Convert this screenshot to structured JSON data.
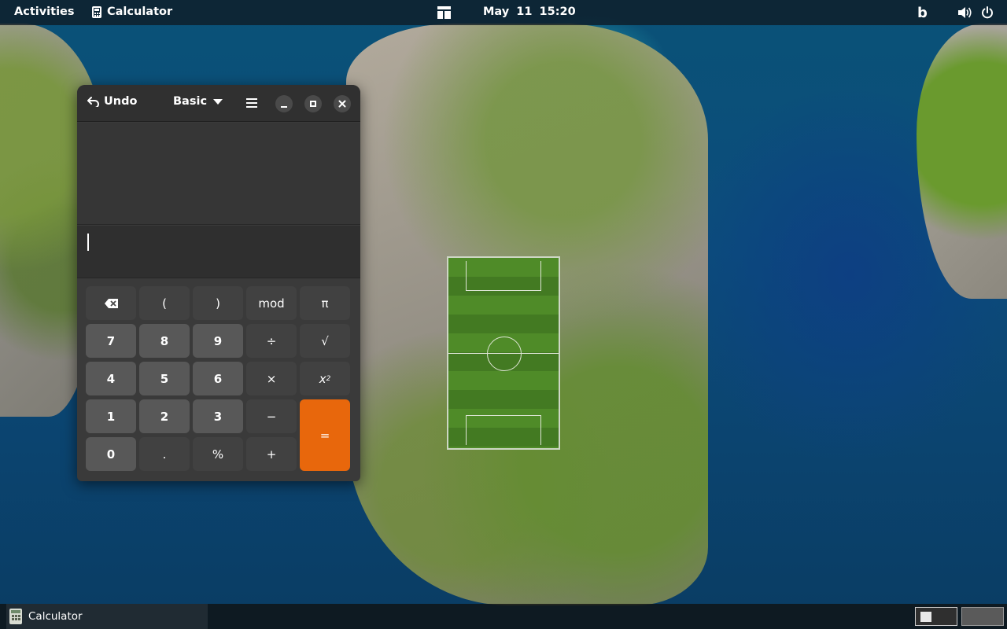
{
  "topbar": {
    "activities": "Activities",
    "app_name": "Calculator",
    "date": "May 11",
    "time": "15:20"
  },
  "window": {
    "undo_label": "Undo",
    "mode_label": "Basic",
    "entry_value": ""
  },
  "keypad": {
    "row1": [
      "(",
      ")",
      "mod",
      "π"
    ],
    "row2": [
      "7",
      "8",
      "9",
      "÷",
      "√"
    ],
    "row3": [
      "4",
      "5",
      "6",
      "×"
    ],
    "row4": [
      "1",
      "2",
      "3",
      "−",
      "="
    ],
    "row5": [
      "0",
      ".",
      "%",
      "+"
    ],
    "power": "x"
  },
  "taskbar": {
    "app_label": "Calculator"
  },
  "icons": {
    "undo": "undo-icon",
    "dropdown": "caret-down-icon",
    "menu": "hamburger-menu-icon",
    "backspace": "backspace-icon",
    "minimize": "minimize-icon",
    "maximize": "maximize-icon",
    "close": "close-icon",
    "bing": "bing-icon",
    "volume": "volume-icon",
    "power": "power-icon"
  },
  "colors": {
    "equals_key": "#e8670c",
    "window_bg": "#3a3a3a"
  }
}
